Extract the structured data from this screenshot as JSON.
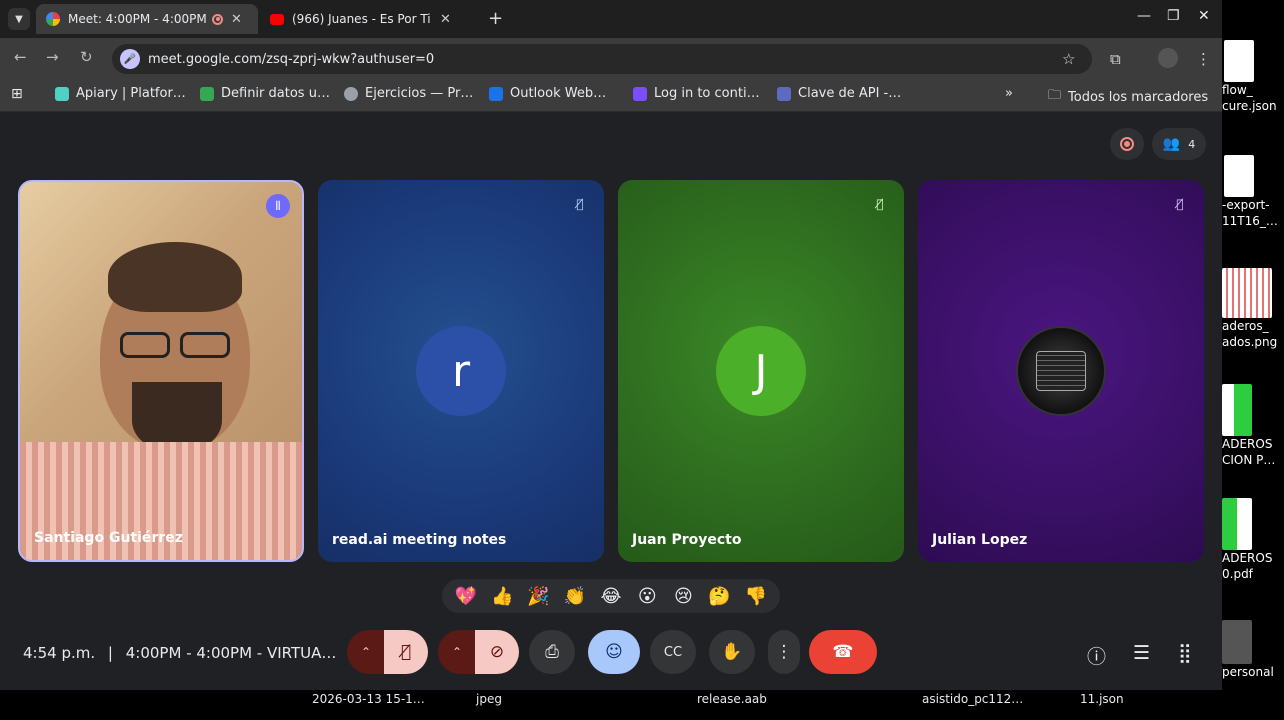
{
  "tabs": [
    {
      "title": "Meet: 4:00PM - 4:00PM",
      "close": "✕"
    },
    {
      "title": "(966) Juanes - Es Por Ti -",
      "close": "✕"
    }
  ],
  "new_tab": "+",
  "window": {
    "minimize": "—",
    "restore": "❐",
    "close": "✕"
  },
  "address": {
    "url": "meet.google.com/zsq-zprj-wkw?authuser=0"
  },
  "bookmarks": [
    {
      "label": "Apiary | Platfor…",
      "color": "#4fd1c5"
    },
    {
      "label": "Definir datos u…",
      "color": "#34a853"
    },
    {
      "label": "Ejercicios — Pr…",
      "color": "#9aa0a6"
    },
    {
      "label": "Outlook Web…",
      "color": "#1a73e8"
    },
    {
      "label": "Log in to conti…",
      "color": "#7c4dff"
    },
    {
      "label": "Clave de API -…",
      "color": "#5c6bc0"
    }
  ],
  "bookmarks_more": "»",
  "all_bookmarks": "Todos los marcadores",
  "participants_count": "4",
  "participants": [
    {
      "name": "Santiago Gutiérrez",
      "bg": "#c9a27a"
    },
    {
      "name": "read.ai meeting notes",
      "initial": "r",
      "bg": "#1b3a7a",
      "avatar": "#2c4fa8"
    },
    {
      "name": "Juan Proyecto",
      "initial": "J",
      "bg": "#2e6b1f",
      "avatar": "#4caf2a"
    },
    {
      "name": "Julian Lopez",
      "bg": "#3a1066",
      "avatar": "#1a1a1a"
    }
  ],
  "reactions": [
    "💖",
    "👍",
    "🎉",
    "👏",
    "😂",
    "😮",
    "😢",
    "🤔",
    "👎"
  ],
  "clock": "4:54 p.m.",
  "separator": "|",
  "meeting_title": "4:00PM - 4:00PM - VIRTUA…",
  "desktop_files": [
    {
      "line1": "flow_",
      "line2": "cure.json"
    },
    {
      "line1": "-export-",
      "line2": "11T16_…"
    },
    {
      "line1": "aderos_",
      "line2": "ados.png"
    },
    {
      "line1": "ADEROS",
      "line2": "CION P…"
    },
    {
      "line1": "ADEROS",
      "line2": "0.pdf"
    },
    {
      "line1": "",
      "line2": "personal"
    }
  ],
  "taskbar": [
    "2026-03-13 15-1…",
    "jpeg",
    "release.aab",
    "asistido_pc112…",
    "11.json"
  ],
  "colors": {
    "accent": "#8ab4f8",
    "end_call": "#ea4335",
    "mic_off": "#f6c9c5"
  }
}
